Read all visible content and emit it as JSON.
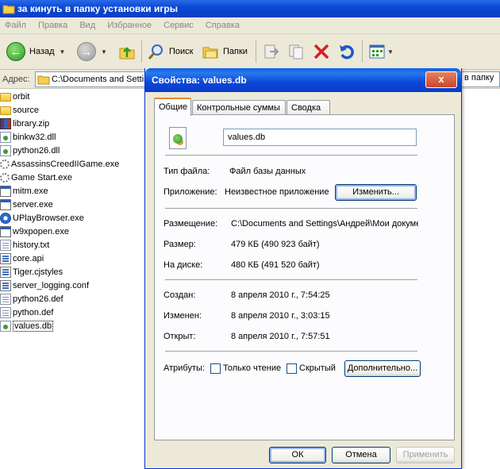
{
  "explorer": {
    "title": "за кинуть в папку установки игры",
    "menu": [
      "Файл",
      "Правка",
      "Вид",
      "Избранное",
      "Сервис",
      "Справка"
    ],
    "toolbar": {
      "back_label": "Назад",
      "search_label": "Поиск",
      "folders_label": "Папки"
    },
    "address": {
      "label": "Адрес:",
      "value": "C:\\Documents and Settin",
      "tail": "в папку"
    },
    "files": [
      {
        "name": "orbit",
        "icon": "folder-icon"
      },
      {
        "name": "source",
        "icon": "folder-icon"
      },
      {
        "name": "library.zip",
        "icon": "zip-icon"
      },
      {
        "name": "binkw32.dll",
        "icon": "dll-icon"
      },
      {
        "name": "python26.dll",
        "icon": "dll-icon"
      },
      {
        "name": "AssassinsCreedIIGame.exe",
        "icon": "gear-icon"
      },
      {
        "name": "Game Start.exe",
        "icon": "gear-icon"
      },
      {
        "name": "mitm.exe",
        "icon": "exe-icon"
      },
      {
        "name": "server.exe",
        "icon": "exe-icon"
      },
      {
        "name": "UPlayBrowser.exe",
        "icon": "uplay-icon"
      },
      {
        "name": "w9xpopen.exe",
        "icon": "exe-icon"
      },
      {
        "name": "history.txt",
        "icon": "text-file-icon"
      },
      {
        "name": "core.api",
        "icon": "api-icon"
      },
      {
        "name": "Tiger.cjstyles",
        "icon": "api-icon"
      },
      {
        "name": "server_logging.conf",
        "icon": "api-icon"
      },
      {
        "name": "python26.def",
        "icon": "text-file-icon"
      },
      {
        "name": "python.def",
        "icon": "text-file-icon"
      },
      {
        "name": "values.db",
        "icon": "db-file-icon"
      }
    ]
  },
  "dialog": {
    "title": "Свойства: values.db",
    "close_label": "x",
    "tabs": [
      "Общие",
      "Контрольные суммы",
      "Сводка"
    ],
    "file_name": "values.db",
    "file_type_label": "Тип файла:",
    "file_type_value": "Файл базы данных",
    "app_label": "Приложение:",
    "app_value": "Неизвестное приложение",
    "change_button": "Изменить...",
    "location_label": "Размещение:",
    "location_value": "C:\\Documents and Settings\\Андрей\\Мои докуме",
    "size_label": "Размер:",
    "size_value": "479 КБ (490 923 байт)",
    "disk_label": "На диске:",
    "disk_value": "480 КБ (491 520 байт)",
    "created_label": "Создан:",
    "created_value": "8 апреля 2010 г., 7:54:25",
    "modified_label": "Изменен:",
    "modified_value": "8 апреля 2010 г., 3:03:15",
    "opened_label": "Открыт:",
    "opened_value": "8 апреля 2010 г., 7:57:51",
    "attributes_label": "Атрибуты:",
    "readonly_label": "Только чтение",
    "hidden_label": "Скрытый",
    "advanced_button": "Дополнительно...",
    "ok_button": "ОК",
    "cancel_button": "Отмена",
    "apply_button": "Применить"
  }
}
